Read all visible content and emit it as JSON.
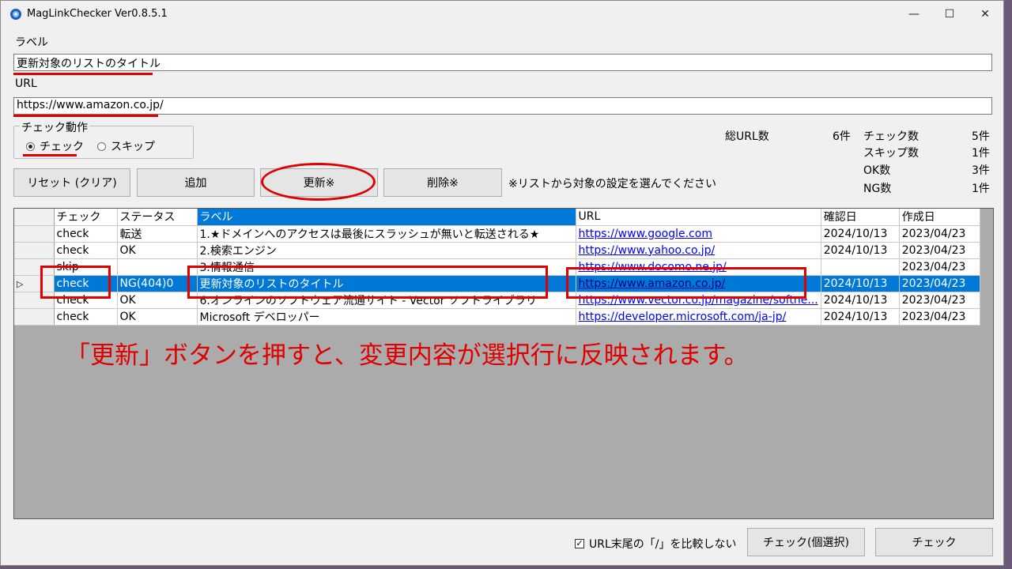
{
  "window": {
    "title": "MagLinkChecker Ver0.8.5.1",
    "minimize_glyph": "—",
    "maximize_glyph": "☐",
    "close_glyph": "✕"
  },
  "form": {
    "label_caption": "ラベル",
    "label_value": "更新対象のリストのタイトル",
    "url_caption": "URL",
    "url_value": "https://www.amazon.co.jp/",
    "check_action": {
      "title": "チェック動作",
      "options": [
        "チェック",
        "スキップ"
      ],
      "selected": "チェック"
    }
  },
  "buttons": {
    "reset": "リセット (クリア)",
    "add": "追加",
    "update": "更新※",
    "delete": "削除※",
    "note": "※リストから対象の設定を選んでください",
    "check_selected": "チェック(個選択)",
    "check_all": "チェック"
  },
  "stats": {
    "total_label": "総URL数",
    "total_value": "6件",
    "check_label": "チェック数",
    "check_value": "5件",
    "skip_label": "スキップ数",
    "skip_value": "1件",
    "ok_label": "OK数",
    "ok_value": "3件",
    "ng_label": "NG数",
    "ng_value": "1件"
  },
  "grid": {
    "columns": [
      "チェック",
      "ステータス",
      "ラベル",
      "URL",
      "確認日",
      "作成日"
    ],
    "selected_column": "ラベル",
    "rows": [
      {
        "check": "check",
        "status": "転送",
        "label": "1.★ドメインへのアクセスは最後にスラッシュが無いと転送される★",
        "url": "https://www.google.com",
        "confirmed": "2024/10/13",
        "created": "2023/04/23",
        "selected": false
      },
      {
        "check": "check",
        "status": "OK",
        "label": "2.検索エンジン",
        "url": "https://www.yahoo.co.jp/",
        "confirmed": "2024/10/13",
        "created": "2023/04/23",
        "selected": false
      },
      {
        "check": "skip",
        "status": "",
        "label": "3.情報通信",
        "url": "https://www.docomo.ne.jp/",
        "confirmed": "",
        "created": "2023/04/23",
        "selected": false
      },
      {
        "check": "check",
        "status": "NG(404)0",
        "label": "更新対象のリストのタイトル",
        "url": "https://www.amazon.co.jp/",
        "confirmed": "2024/10/13",
        "created": "2023/04/23",
        "selected": true
      },
      {
        "check": "check",
        "status": "OK",
        "label": "6.オンラインのソフトウェア流通サイト - Vector ソフトライブラリ",
        "url": "https://www.vector.co.jp/magazine/softne...",
        "confirmed": "2024/10/13",
        "created": "2023/04/23",
        "selected": false
      },
      {
        "check": "check",
        "status": "OK",
        "label": "Microsoft デベロッパー",
        "url": "https://developer.microsoft.com/ja-jp/",
        "confirmed": "2024/10/13",
        "created": "2023/04/23",
        "selected": false
      }
    ]
  },
  "caption": "「更新」ボタンを押すと、変更内容が選択行に反映されます。",
  "footer": {
    "checkbox_label": "URL末尾の「/」を比較しない",
    "checkbox_checked": true
  },
  "colors": {
    "annotation": "#e00000",
    "selection": "#0078d7"
  }
}
